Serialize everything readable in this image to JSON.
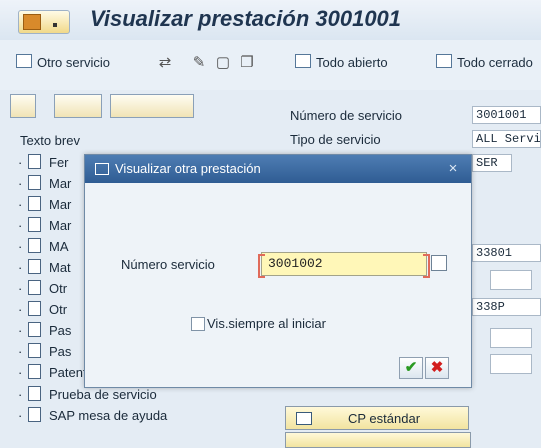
{
  "window": {
    "title": "Visualizar prestación 3001001"
  },
  "toolbar": {
    "otro_servicio": "Otro servicio",
    "todo_abierto": "Todo abierto",
    "todo_cerrado": "Todo cerrado"
  },
  "tree": {
    "header": "Texto brev",
    "items": [
      {
        "label": "Fer"
      },
      {
        "label": "Mar"
      },
      {
        "label": "Mar"
      },
      {
        "label": "Mar"
      },
      {
        "label": "MA"
      },
      {
        "label": "Mat"
      },
      {
        "label": "Otr"
      },
      {
        "label": "Otr"
      },
      {
        "label": "Pas"
      },
      {
        "label": "Pas"
      },
      {
        "label": "Patente PAGOS ANTICIPAD"
      },
      {
        "label": "Prueba de servicio"
      },
      {
        "label": "SAP mesa de ayuda"
      }
    ]
  },
  "details": {
    "numero_servicio_label": "Número de servicio",
    "numero_servicio_value": "3001001",
    "tipo_servicio_label": "Tipo de servicio",
    "tipo_servicio_value": "ALL Servi",
    "ser_value": "SER",
    "val_1": "33801",
    "val_2": "338P",
    "cp_estandar": "CP estándar"
  },
  "dialog": {
    "title": "Visualizar otra prestación",
    "close": "×",
    "field_label": "Número servicio",
    "field_value": "3001002",
    "checkbox_label": "Vis.siempre al iniciar",
    "ok": "✔",
    "cancel": "✖"
  },
  "colors": {
    "dialog_titlebar": "#3c6aa3",
    "input_highlight": "#fff7b8"
  }
}
